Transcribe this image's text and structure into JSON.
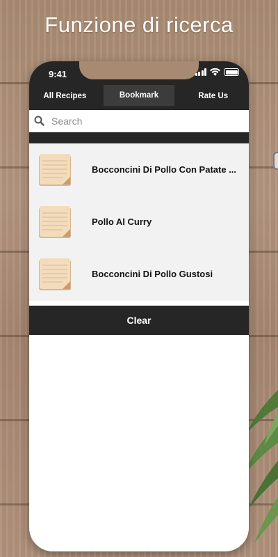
{
  "headline": "Funzione di ricerca",
  "status": {
    "time": "9:41"
  },
  "tabs": [
    {
      "label": "All Recipes",
      "active": false
    },
    {
      "label": "Bookmark",
      "active": true
    },
    {
      "label": "Rate Us",
      "active": false
    }
  ],
  "search": {
    "placeholder": "Search",
    "icon": "search-icon"
  },
  "results": [
    {
      "title": "Bocconcini Di Pollo Con Patate ...",
      "icon": "recipe-note-icon"
    },
    {
      "title": "Pollo Al Curry",
      "icon": "recipe-note-icon"
    },
    {
      "title": "Bocconcini Di Pollo Gustosi",
      "icon": "recipe-note-icon"
    }
  ],
  "clear_label": "Clear",
  "colors": {
    "bar": "#262626",
    "list_bg": "#f2f2f2",
    "wood": "#a88a72"
  }
}
